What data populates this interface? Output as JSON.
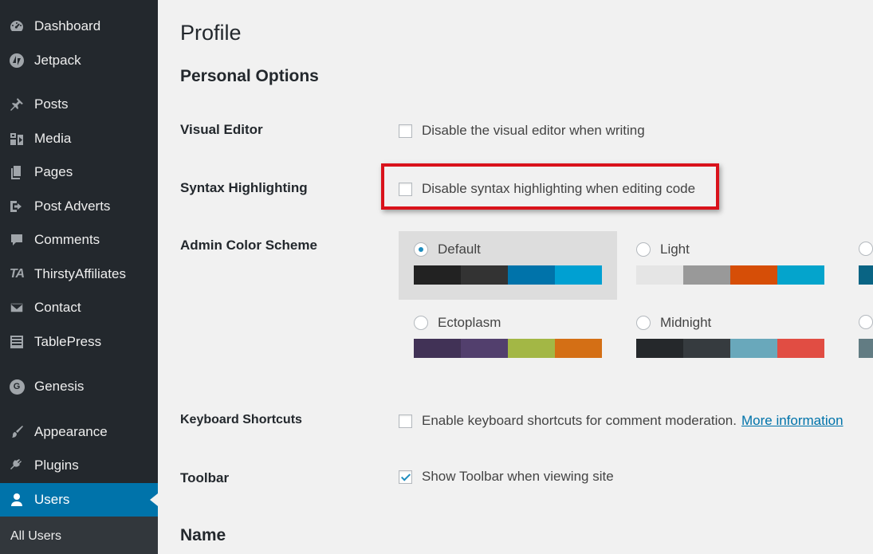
{
  "sidebar": {
    "items": [
      {
        "label": "Dashboard",
        "icon": "dashboard-icon"
      },
      {
        "label": "Jetpack",
        "icon": "jetpack-icon"
      },
      {
        "label": "Posts",
        "icon": "pin-icon"
      },
      {
        "label": "Media",
        "icon": "media-icon"
      },
      {
        "label": "Pages",
        "icon": "pages-icon"
      },
      {
        "label": "Post Adverts",
        "icon": "signin-icon"
      },
      {
        "label": "Comments",
        "icon": "comment-icon"
      },
      {
        "label": "ThirstyAffiliates",
        "icon": "ta-icon",
        "icon_text": "TA"
      },
      {
        "label": "Contact",
        "icon": "envelope-icon"
      },
      {
        "label": "TablePress",
        "icon": "table-icon"
      },
      {
        "label": "Genesis",
        "icon": "genesis-icon",
        "icon_text": "G"
      },
      {
        "label": "Appearance",
        "icon": "brush-icon"
      },
      {
        "label": "Plugins",
        "icon": "plug-icon"
      },
      {
        "label": "Users",
        "icon": "user-icon",
        "active": true
      }
    ],
    "submenu": {
      "label": "All Users"
    },
    "colors": {
      "bg": "#23282d",
      "active": "#0073aa",
      "submenu_bg": "#32373c"
    }
  },
  "main": {
    "page_title": "Profile",
    "personal_options_title": "Personal Options",
    "visual_editor": {
      "label": "Visual Editor",
      "option": "Disable the visual editor when writing",
      "checked": false
    },
    "syntax_highlighting": {
      "label": "Syntax Highlighting",
      "option": "Disable syntax highlighting when editing code",
      "checked": false
    },
    "admin_color_scheme": {
      "label": "Admin Color Scheme",
      "schemes": [
        {
          "name": "Default",
          "selected": true,
          "colors": [
            "#222222",
            "#333333",
            "#0073aa",
            "#00a0d2"
          ]
        },
        {
          "name": "Light",
          "selected": false,
          "colors": [
            "#e5e5e5",
            "#999999",
            "#d64e07",
            "#04a4cc"
          ]
        },
        {
          "name": "Ectoplasm",
          "selected": false,
          "colors": [
            "#413256",
            "#523f6d",
            "#a3b745",
            "#d46f15"
          ]
        },
        {
          "name": "Midnight",
          "selected": false,
          "colors": [
            "#25282b",
            "#363b3f",
            "#69a8bb",
            "#e14d43"
          ]
        }
      ],
      "partial_colors": [
        "#096484",
        "#627c83"
      ]
    },
    "keyboard_shortcuts": {
      "label": "Keyboard Shortcuts",
      "option": "Enable keyboard shortcuts for comment moderation.",
      "link": "More information",
      "checked": false
    },
    "toolbar": {
      "label": "Toolbar",
      "option": "Show Toolbar when viewing site",
      "checked": true
    },
    "name_title": "Name",
    "highlight_color": "#d9121b"
  }
}
